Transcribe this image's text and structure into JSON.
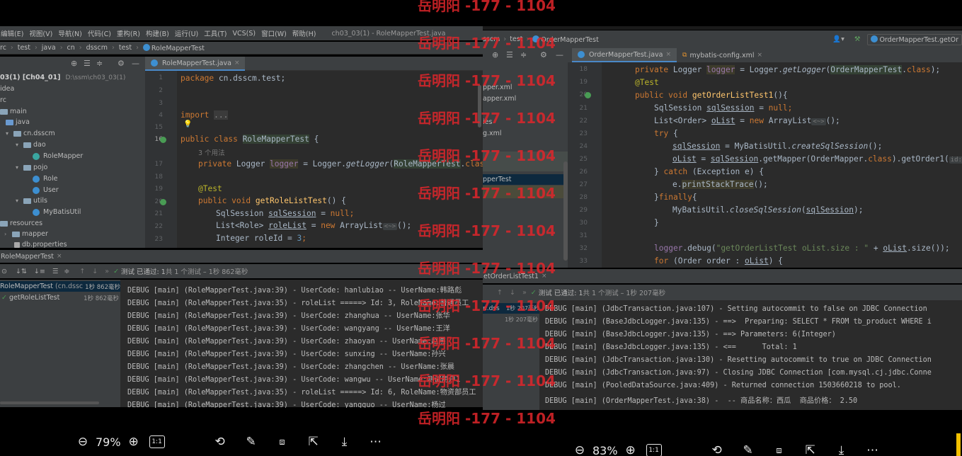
{
  "left": {
    "menu": [
      "编辑(E)",
      "视图(V)",
      "导航(N)",
      "代码(C)",
      "重构(R)",
      "构建(B)",
      "运行(U)",
      "工具(T)",
      "VCS(S)",
      "窗口(W)",
      "帮助(H)"
    ],
    "window_title": "ch03_03(1) - RoleMapperTest.java",
    "breadcrumb": [
      "rc",
      "test",
      "java",
      "cn",
      "dsscm",
      "test",
      "RoleMapperTest"
    ],
    "tree": {
      "project": "03(1) [Ch04_01]",
      "project_path": "D:\\ssm\\ch03_03(1)",
      "idea": "idea",
      "src": "rc",
      "main": "main",
      "java": "java",
      "pkg": "cn.dsscm",
      "dao": "dao",
      "role_mapper": "RoleMapper",
      "pojo": "pojo",
      "role": "Role",
      "user": "User",
      "utils": "utils",
      "mybatis_util": "MyBatisUtil",
      "resources": "resources",
      "mapper": "mapper",
      "db_properties": "db.properties"
    },
    "editor_tab": "RoleMapperTest.java",
    "line_numbers": [
      "1",
      "2",
      "3",
      "4",
      "15",
      "16",
      "",
      "17",
      "18",
      "19",
      "20",
      "21",
      "22",
      "23"
    ],
    "code": {
      "package_kw": "package",
      "package_name": " cn.dsscm.test;",
      "import_kw": "import",
      "import_fold": "...",
      "public_kw": "public class ",
      "class_name": "RoleMapperTest",
      "brace_open": " {",
      "usages_hint": "3 个用法",
      "private_kw": "private ",
      "logger_type": "Logger ",
      "logger_field": "logger",
      "logger_rest_1": " = Logger.",
      "get_logger": "getLogger",
      "logger_rest_2": "(",
      "logger_class": "RoleMapperTest",
      "logger_rest_3": ".",
      "class_kw": "class",
      "logger_rest_4": ");",
      "test_ann": "@Test",
      "public_void": "public void ",
      "method_name": "getRoleListTest",
      "method_rest": "() {",
      "sql_decl": "SqlSession ",
      "sql_var": "sqlSession",
      "sql_rest": " = ",
      "null_kw": "null",
      "semi": ";",
      "list_decl": "List<Role> ",
      "list_var": "roleList",
      "list_rest_1": " = ",
      "new_kw": "new ",
      "list_rest_2": "ArrayList",
      "list_inlay": "<~>",
      "list_rest_3": "();",
      "int_decl": "Integer roleId = ",
      "int_val": "3",
      "int_semi": ";"
    },
    "run_tab": "RoleMapperTest",
    "run_status_label": "测试 已通过: ",
    "run_status_count": "1",
    "run_status_detail": "共 1 个测试 – 1秒 862毫秒",
    "run_tree": [
      {
        "label": "RoleMapperTest",
        "sub": "(cn.dssc",
        "time": "1秒 862毫秒"
      },
      {
        "label": "getRoleListTest",
        "sub": "",
        "time": "1秒 862毫秒"
      }
    ],
    "console": [
      "DEBUG [main] (RoleMapperTest.java:39) - UserCode: hanlubiao -- UserName:韩路彪",
      "DEBUG [main] (RoleMapperTest.java:35) - roleList =====> Id: 3, RoleName:普通员工",
      "DEBUG [main] (RoleMapperTest.java:39) - UserCode: zhanghua -- UserName:张华",
      "DEBUG [main] (RoleMapperTest.java:39) - UserCode: wangyang -- UserName:王洋",
      "DEBUG [main] (RoleMapperTest.java:39) - UserCode: zhaoyan -- UserName:赵燕",
      "DEBUG [main] (RoleMapperTest.java:39) - UserCode: sunxing -- UserName:孙兴",
      "DEBUG [main] (RoleMapperTest.java:39) - UserCode: zhangchen -- UserName:张晨",
      "DEBUG [main] (RoleMapperTest.java:39) - UserCode: wangwu -- UserName:测试用户1",
      "DEBUG [main] (RoleMapperTest.java:35) - roleList =====> Id: 6, RoleName:物资部员工",
      "DEBUG [main] (RoleMapperTest.java:39) - UserCode: yangguo -- UserName:杨过"
    ],
    "viewer": {
      "zoom": "79%",
      "ratio": "1:1"
    }
  },
  "right": {
    "breadcrumb": [
      "sscm",
      "test",
      "OrderMapperTest"
    ],
    "nav_dropdown": "OrderMapperTest.getOr",
    "tabs": [
      "OrderMapperTest.java",
      "mybatis-config.xml"
    ],
    "tree": [
      "pper.xml",
      "apper.xml",
      "ies",
      "g.xml",
      "pperTest"
    ],
    "line_numbers": [
      "18",
      "19",
      "20",
      "21",
      "22",
      "23",
      "24",
      "25",
      "26",
      "27",
      "28",
      "29",
      "30",
      "31",
      "32",
      "33"
    ],
    "code": {
      "l18_priv": "private ",
      "l18_type": "Logger ",
      "l18_field": "logger",
      "l18_r1": " = Logger.",
      "l18_fn": "getLogger",
      "l18_r2": "(",
      "l18_cls": "OrderMapperTest",
      "l18_r3": ".",
      "l18_kw": "class",
      "l18_r4": ");",
      "l19": "@Test",
      "l20_kw": "public void ",
      "l20_fn": "getOrderListTest1",
      "l20_r": "(){",
      "l21_a": "SqlSession ",
      "l21_var": "sqlSession",
      "l21_b": " = ",
      "l21_null": "null",
      "l21_c": ";",
      "l22_a": "List<Order> ",
      "l22_var": "oList",
      "l22_b": " = ",
      "l22_new": "new ",
      "l22_c": "ArrayList",
      "l22_inlay": "<~>",
      "l22_d": "();",
      "l23_kw": "try",
      "l23_r": " {",
      "l24_var": "sqlSession",
      "l24_a": " = MyBatisUtil.",
      "l24_fn": "createSqlSession",
      "l24_b": "();",
      "l25_var": "oList",
      "l25_a": " = ",
      "l25_var2": "sqlSession",
      "l25_b": ".getMapper(OrderMapper.",
      "l25_kw": "class",
      "l25_c": ").getOrder1(",
      "l25_inlay": "id:",
      "l25_null": "null",
      "l26_a": "} ",
      "l26_kw": "catch",
      "l26_b": " (Exception e) {",
      "l27_a": "e.",
      "l27_fn": "printStackTrace",
      "l27_b": "();",
      "l28_a": "}",
      "l28_kw": "finally",
      "l28_b": "{",
      "l29_a": "MyBatisUtil.",
      "l29_fn": "closeSqlSession",
      "l29_b": "(",
      "l29_var": "sqlSession",
      "l29_c": ");",
      "l30": "}",
      "l32_fld": "logger",
      "l32_a": ".debug(",
      "l32_str": "\"getOrderListTest oList.size : \"",
      "l32_b": " + ",
      "l32_var": "oList",
      "l32_c": ".size());",
      "l33_kw": "for",
      "l33_a": " (Order order : ",
      "l33_var": "oList",
      "l33_b": ") {"
    },
    "run_tab": "etOrderListTest1",
    "run_status_label": "测试 已通过: ",
    "run_status_count": "1",
    "run_status_detail": "共 1 个测试 – 1秒 207毫秒",
    "run_tree": [
      {
        "label": "n.dss",
        "time": "1秒 207毫秒"
      },
      {
        "label": "",
        "time": "1秒 207毫秒"
      }
    ],
    "console": [
      "DEBUG [main] (JdbcTransaction.java:107) - Setting autocommit to false on JDBC Connection",
      "DEBUG [main] (BaseJdbcLogger.java:135) - ==>  Preparing: SELECT * FROM tb_product WHERE i",
      "DEBUG [main] (BaseJdbcLogger.java:135) - ==> Parameters: 6(Integer)",
      "DEBUG [main] (BaseJdbcLogger.java:135) - <==      Total: 1",
      "DEBUG [main] (JdbcTransaction.java:130) - Resetting autocommit to true on JDBC Connection",
      "DEBUG [main] (JdbcTransaction.java:97) - Closing JDBC Connection [com.mysql.cj.jdbc.Conne",
      "DEBUG [main] (PooledDataSource.java:409) - Returned connection 1503660218 to pool.",
      "DEBUG [main] (OrderMapperTest.java:38) -  -- 商品名称：西瓜  商品价格： 2.50"
    ],
    "viewer": {
      "zoom": "83%",
      "ratio": "1:1"
    }
  },
  "watermark": "岳明阳 -177 - 1104"
}
